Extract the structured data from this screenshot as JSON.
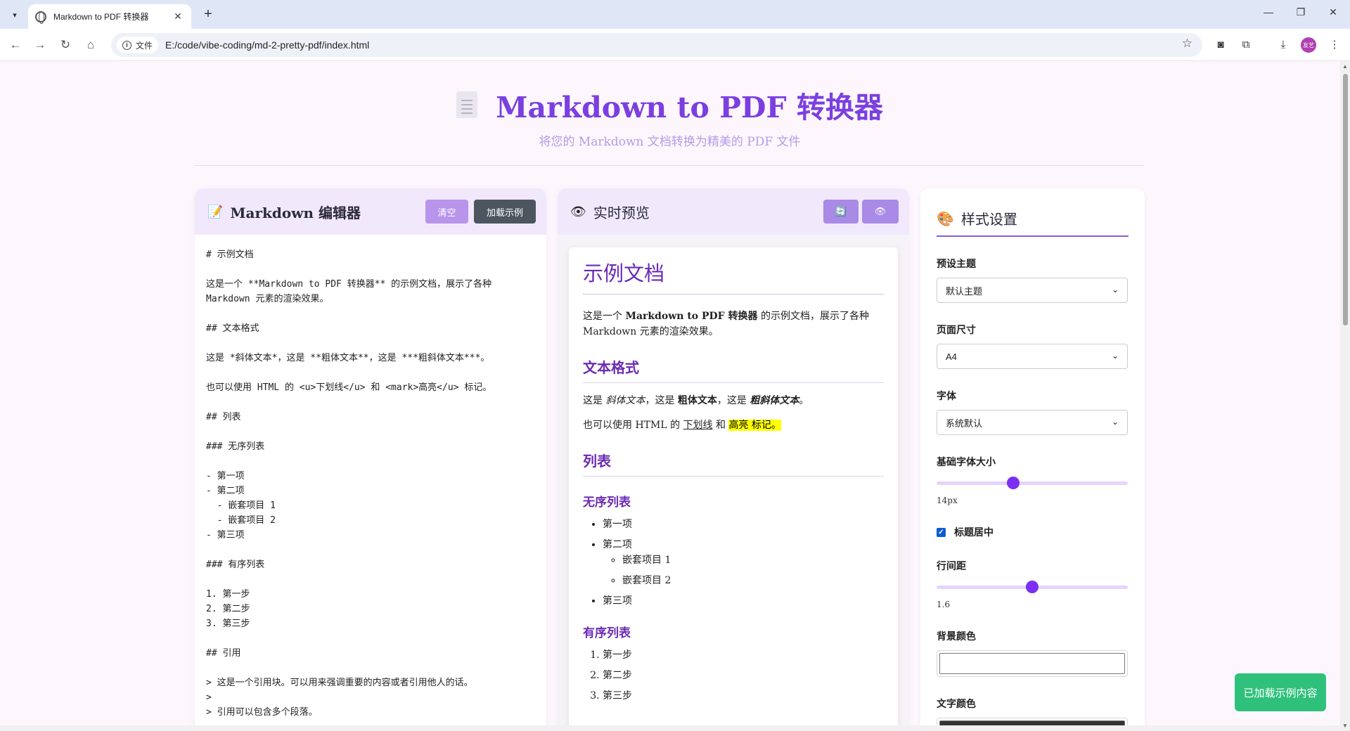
{
  "browser": {
    "tab_title": "Markdown to PDF 转换器",
    "info_label": "文件",
    "url": "E:/code/vibe-coding/md-2-pretty-pdf/index.html",
    "avatar_text": "友艺"
  },
  "header": {
    "title": "Markdown to PDF 转换器",
    "subtitle": "将您的 Markdown 文档转换为精美的 PDF 文件"
  },
  "editor": {
    "title": "Markdown 编辑器",
    "clear_label": "清空",
    "load_example_label": "加载示例",
    "content": "# 示例文档\n\n这是一个 **Markdown to PDF 转换器** 的示例文档，展示了各种\nMarkdown 元素的渲染效果。\n\n## 文本格式\n\n这是 *斜体文本*，这是 **粗体文本**，这是 ***粗斜体文本***。\n\n也可以使用 HTML 的 <u>下划线</u> 和 <mark>高亮</u> 标记。\n\n## 列表\n\n### 无序列表\n\n- 第一项\n- 第二项\n  - 嵌套项目 1\n  - 嵌套项目 2\n- 第三项\n\n### 有序列表\n\n1. 第一步\n2. 第二步\n3. 第三步\n\n## 引用\n\n> 这是一个引用块。可以用来强调重要的内容或者引用他人的话。\n>\n> 引用可以包含多个段落。"
  },
  "preview": {
    "title": "实时预览",
    "refresh_icon": "refresh-icon",
    "eye_icon": "eye-icon",
    "doc": {
      "h1": "示例文档",
      "p1_a": "这是一个 ",
      "p1_bold": "Markdown to PDF 转换器",
      "p1_b": " 的示例文档，展示了各种 Markdown 元素的渲染效果。",
      "h2_format": "文本格式",
      "p2_a": "这是 ",
      "p2_italic": "斜体文本",
      "p2_b": "，这是 ",
      "p2_bold": "粗体文本",
      "p2_c": "，这是 ",
      "p2_bolditalic": "粗斜体文本",
      "p2_d": "。",
      "p3_a": "也可以使用 HTML 的 ",
      "p3_underline": "下划线",
      "p3_b": " 和 ",
      "p3_mark": "高亮 标记。",
      "h2_list": "列表",
      "h3_unordered": "无序列表",
      "ul": [
        "第一项",
        "第二项",
        "第三项"
      ],
      "ul_nested": [
        "嵌套项目 1",
        "嵌套项目 2"
      ],
      "h3_ordered": "有序列表",
      "ol": [
        "第一步",
        "第二步",
        "第三步"
      ]
    }
  },
  "settings": {
    "title": "样式设置",
    "theme_label": "预设主题",
    "theme_value": "默认主题",
    "page_size_label": "页面尺寸",
    "page_size_value": "A4",
    "font_label": "字体",
    "font_value": "系统默认",
    "font_size_label": "基础字体大小",
    "font_size_value": "14px",
    "font_size_fraction": 0.4,
    "center_title_label": "标题居中",
    "center_title_checked": true,
    "line_height_label": "行间距",
    "line_height_value": "1.6",
    "line_height_fraction": 0.5,
    "bg_color_label": "背景颜色",
    "bg_color": "#ffffff",
    "text_color_label": "文字颜色",
    "text_color": "#333333"
  },
  "toast": {
    "message": "已加载示例内容"
  },
  "colors": {
    "accent": "#7b3fe0",
    "toast_bg": "#2fc17c"
  }
}
